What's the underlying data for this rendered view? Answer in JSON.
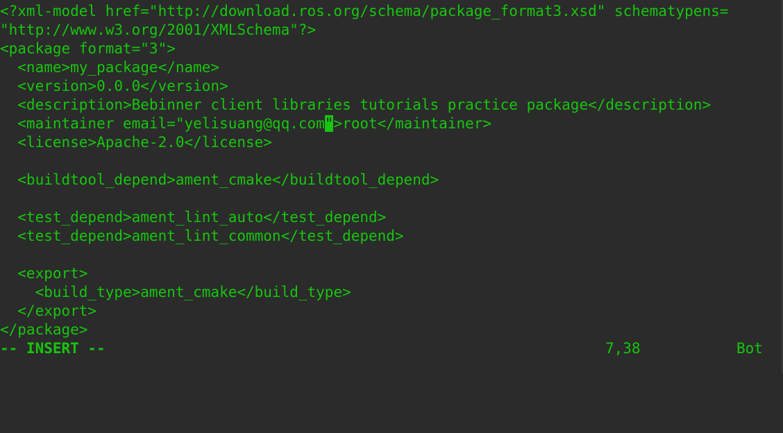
{
  "editor": {
    "lines": [
      "<?xml-model href=\"http://download.ros.org/schema/package_format3.xsd\" schematypens=",
      "\"http://www.w3.org/2001/XMLSchema\"?>",
      "<package format=\"3\">",
      "  <name>my_package</name>",
      "  <version>0.0.0</version>",
      "  <description>Bebinner client libraries tutorials practice package</description>",
      "  <maintainer email=\"yelisuang@qq.com",
      "  <license>Apache-2.0</license>",
      "",
      "  <buildtool_depend>ament_cmake</buildtool_depend>",
      "",
      "  <test_depend>ament_lint_auto</test_depend>",
      "  <test_depend>ament_lint_common</test_depend>",
      "",
      "  <export>",
      "    <build_type>ament_cmake</build_type>",
      "  </export>",
      "</package>"
    ],
    "cursor_line": {
      "before": "  <maintainer email=\"yelisuang@qq.com",
      "cursor_char": "\"",
      "after": ">root</maintainer>"
    }
  },
  "status": {
    "mode": "-- INSERT --",
    "cursor_position": "7,38",
    "scroll_position": "Bot"
  },
  "colors": {
    "background": "#2b2b2b",
    "text": "#16c60c"
  }
}
